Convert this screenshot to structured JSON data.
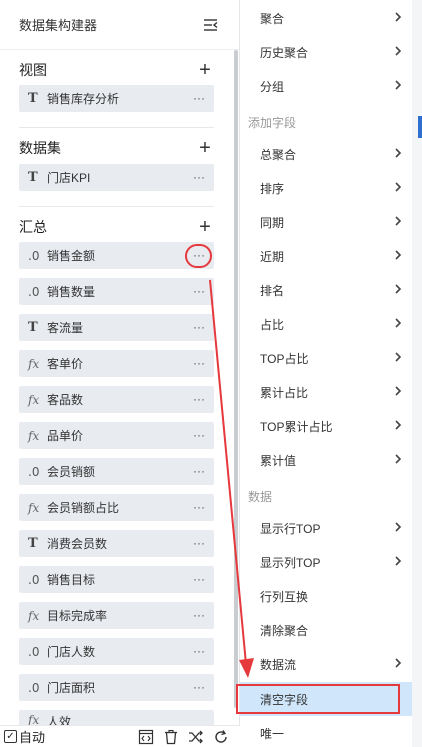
{
  "panel": {
    "title": "数据集构建器"
  },
  "sections": {
    "view": {
      "title": "视图",
      "items": [
        {
          "icon": "T",
          "label": "销售库存分析"
        }
      ]
    },
    "dataset": {
      "title": "数据集",
      "items": [
        {
          "icon": "T",
          "label": "门店KPI"
        }
      ]
    },
    "summary": {
      "title": "汇总",
      "items": [
        {
          "icon": ".0",
          "label": "销售金额"
        },
        {
          "icon": ".0",
          "label": "销售数量"
        },
        {
          "icon": "T",
          "label": "客流量"
        },
        {
          "icon": "fx",
          "label": "客单价"
        },
        {
          "icon": "fx",
          "label": "客品数"
        },
        {
          "icon": "fx",
          "label": "品单价"
        },
        {
          "icon": ".0",
          "label": "会员销额"
        },
        {
          "icon": "fx",
          "label": "会员销额占比"
        },
        {
          "icon": "T",
          "label": "消费会员数"
        },
        {
          "icon": ".0",
          "label": "销售目标"
        },
        {
          "icon": "fx",
          "label": "目标完成率"
        },
        {
          "icon": ".0",
          "label": "门店人数"
        },
        {
          "icon": ".0",
          "label": "门店面积"
        },
        {
          "icon": "fx",
          "label": "人效"
        }
      ]
    }
  },
  "more_label": "···",
  "bottom": {
    "auto_label": "自动"
  },
  "menu": {
    "items": [
      {
        "label": "聚合",
        "arrow": true
      },
      {
        "label": "历史聚合",
        "arrow": true
      },
      {
        "label": "分组",
        "arrow": true
      },
      {
        "group": "添加字段"
      },
      {
        "label": "总聚合",
        "arrow": true
      },
      {
        "label": "排序",
        "arrow": true
      },
      {
        "label": "同期",
        "arrow": true
      },
      {
        "label": "近期",
        "arrow": true
      },
      {
        "label": "排名",
        "arrow": true
      },
      {
        "label": "占比",
        "arrow": true
      },
      {
        "label": "TOP占比",
        "arrow": true
      },
      {
        "label": "累计占比",
        "arrow": true
      },
      {
        "label": "TOP累计占比",
        "arrow": true
      },
      {
        "label": "累计值",
        "arrow": true
      },
      {
        "group": "数据"
      },
      {
        "label": "显示行TOP",
        "arrow": true
      },
      {
        "label": "显示列TOP",
        "arrow": true
      },
      {
        "label": "行列互换",
        "arrow": false
      },
      {
        "label": "清除聚合",
        "arrow": false
      },
      {
        "label": "数据流",
        "arrow": true
      },
      {
        "label": "清空字段",
        "arrow": false,
        "active": true
      },
      {
        "label": "唯一",
        "arrow": false
      }
    ]
  },
  "colors": {
    "accent_red": "#e5393d",
    "active_bg": "#cfe6fb",
    "field_bg": "#e8ebf0"
  }
}
